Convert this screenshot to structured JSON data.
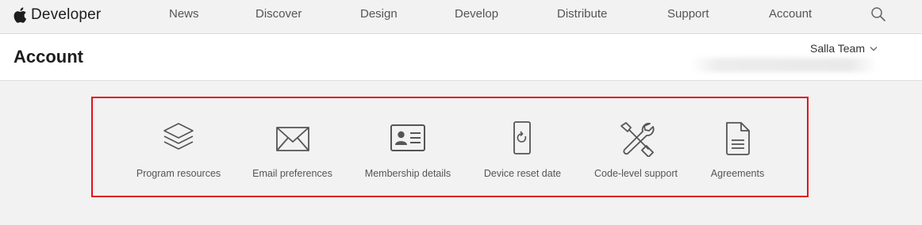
{
  "brand": {
    "name": "Developer",
    "logo_icon": "apple-logo-icon"
  },
  "nav": {
    "items": [
      {
        "label": "News"
      },
      {
        "label": "Discover"
      },
      {
        "label": "Design"
      },
      {
        "label": "Develop"
      },
      {
        "label": "Distribute"
      },
      {
        "label": "Support"
      },
      {
        "label": "Account"
      }
    ],
    "search_icon": "search-icon"
  },
  "header": {
    "title": "Account",
    "team_selector": "Salla Team",
    "team_selector_icon": "chevron-down-icon"
  },
  "tiles": [
    {
      "label": "Program resources",
      "icon": "layers-icon"
    },
    {
      "label": "Email preferences",
      "icon": "envelope-icon"
    },
    {
      "label": "Membership details",
      "icon": "id-card-icon"
    },
    {
      "label": "Device reset date",
      "icon": "device-reset-icon"
    },
    {
      "label": "Code-level support",
      "icon": "tools-icon"
    },
    {
      "label": "Agreements",
      "icon": "document-icon"
    }
  ],
  "colors": {
    "highlight": "#e3101a",
    "icon": "#555555",
    "page_background": "#f2f2f2"
  }
}
